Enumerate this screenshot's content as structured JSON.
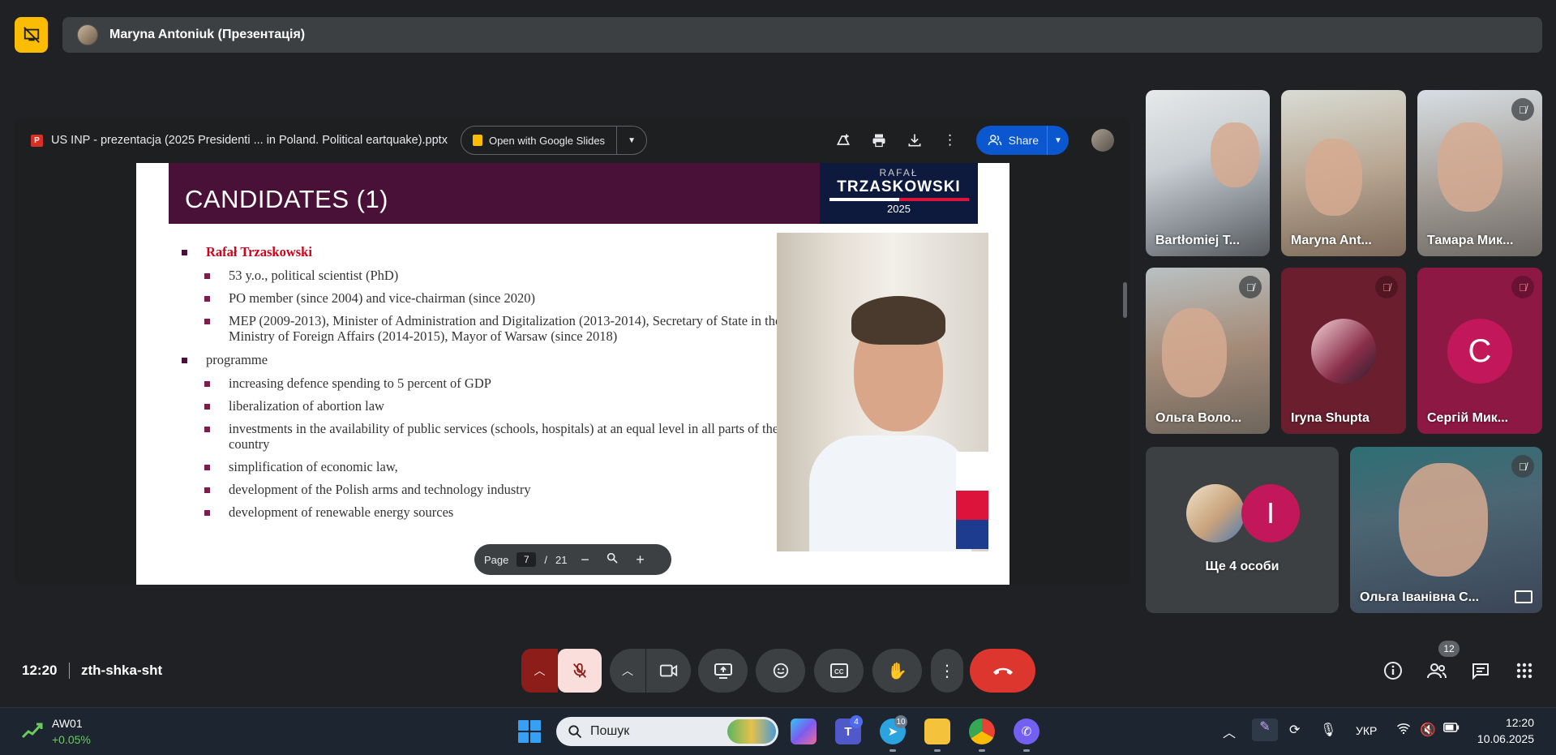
{
  "presenter": {
    "name": "Maryna Antoniuk (Презентація)"
  },
  "viewer": {
    "file_title": "US INP - prezentacja (2025 Presidenti ... in Poland. Political eartquake).pptx",
    "open_with_label": "Open with Google Slides",
    "share_label": "Share",
    "icons": [
      "add-to-drive-icon",
      "print-icon",
      "download-icon",
      "more-vert-icon"
    ]
  },
  "slide": {
    "title": "CANDIDATES (1)",
    "logo": {
      "top": "RAFAŁ",
      "name": "TRZASKOWSKI",
      "year": "2025"
    },
    "candidate_name": "Rafał Trzaskowski",
    "details": [
      "53 y.o., political scientist (PhD)",
      "PO member (since 2004) and vice-chairman (since 2020)",
      "MEP (2009-2013), Minister of Administration and Digitalization (2013-2014), Secretary of State in the Ministry of Foreign Affairs (2014-2015), Mayor of Warsaw (since 2018)"
    ],
    "programme_label": "programme",
    "programme": [
      "increasing defence spending to 5 percent of GDP",
      "liberalization of abortion law",
      "investments in the availability of public services (schools, hospitals) at an equal level in all parts of the country",
      "simplification of economic law,",
      "development of the Polish arms and technology industry",
      "development of renewable energy sources"
    ]
  },
  "page_nav": {
    "label": "Page",
    "current": "7",
    "separator": "/",
    "total": "21"
  },
  "participants": [
    {
      "name": "Bartłomiej T...",
      "muted": false
    },
    {
      "name": "Maryna Ant...",
      "muted": false
    },
    {
      "name": "Тамара Мик...",
      "muted": true
    },
    {
      "name": "Ольга Воло...",
      "muted": true
    },
    {
      "name": "Iryna Shupta",
      "muted": true
    },
    {
      "name": "Сергій Мик...",
      "muted": true,
      "initial": "С"
    },
    {
      "name": "Ольга Іванівна С...",
      "muted": true
    }
  ],
  "more_people": {
    "label": "Ще 4 особи",
    "initial": "I"
  },
  "meeting": {
    "time": "12:20",
    "code": "zth-shka-sht",
    "people_count": "12"
  },
  "taskbar": {
    "stock_name": "AW01",
    "stock_change": "+0.05%",
    "search_placeholder": "Пошук",
    "teams_badge": "4",
    "telegram_badge": "10",
    "language": "УКР",
    "time": "12:20",
    "date": "10.06.2025"
  },
  "colors": {
    "background": "#202124",
    "accent_yellow": "#fbbc04",
    "end_call_red": "#dc362e",
    "share_blue": "#0b57d0",
    "slide_header": "#4a1138"
  }
}
